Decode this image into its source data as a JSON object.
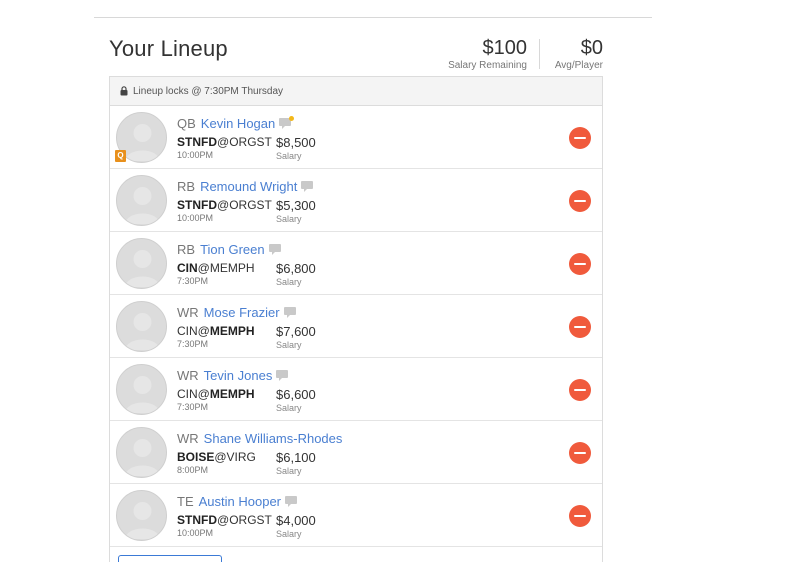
{
  "header": {
    "title": "Your Lineup",
    "salary_remaining": "$100",
    "salary_remaining_label": "Salary Remaining",
    "avg_player": "$0",
    "avg_player_label": "Avg/Player"
  },
  "lock_bar": {
    "text": "Lineup locks @ 7:30PM Thursday"
  },
  "players": [
    {
      "pos": "QB",
      "name": "Kevin Hogan",
      "team_a": "STNFD",
      "team_b": "ORGST",
      "bold": "a",
      "time": "10:00PM",
      "salary": "$8,500",
      "salary_label": "Salary",
      "badge": "Q",
      "news_alert": true,
      "news": true
    },
    {
      "pos": "RB",
      "name": "Remound Wright",
      "team_a": "STNFD",
      "team_b": "ORGST",
      "bold": "a",
      "time": "10:00PM",
      "salary": "$5,300",
      "salary_label": "Salary",
      "badge": "",
      "news_alert": false,
      "news": true
    },
    {
      "pos": "RB",
      "name": "Tion Green",
      "team_a": "CIN",
      "team_b": "MEMPH",
      "bold": "a",
      "time": "7:30PM",
      "salary": "$6,800",
      "salary_label": "Salary",
      "badge": "",
      "news_alert": false,
      "news": true
    },
    {
      "pos": "WR",
      "name": "Mose Frazier",
      "team_a": "CIN",
      "team_b": "MEMPH",
      "bold": "b",
      "time": "7:30PM",
      "salary": "$7,600",
      "salary_label": "Salary",
      "badge": "",
      "news_alert": false,
      "news": true
    },
    {
      "pos": "WR",
      "name": "Tevin Jones",
      "team_a": "CIN",
      "team_b": "MEMPH",
      "bold": "b",
      "time": "7:30PM",
      "salary": "$6,600",
      "salary_label": "Salary",
      "badge": "",
      "news_alert": false,
      "news": true
    },
    {
      "pos": "WR",
      "name": "Shane Williams-Rhodes",
      "team_a": "BOISE",
      "team_b": "VIRG",
      "bold": "a",
      "time": "8:00PM",
      "salary": "$6,100",
      "salary_label": "Salary",
      "badge": "",
      "news_alert": false,
      "news": false
    },
    {
      "pos": "TE",
      "name": "Austin Hooper",
      "team_a": "STNFD",
      "team_b": "ORGST",
      "bold": "a",
      "time": "10:00PM",
      "salary": "$4,000",
      "salary_label": "Salary",
      "badge": "",
      "news_alert": false,
      "news": true
    }
  ],
  "colors": {
    "link": "#4a7fd1",
    "remove": "#f05a3c",
    "badge": "#e8901c",
    "news_alert": "#f3b81a"
  },
  "icons": {
    "lock": "lock-icon",
    "news": "news-icon",
    "remove": "remove-icon",
    "avatar": "avatar-placeholder-icon"
  }
}
